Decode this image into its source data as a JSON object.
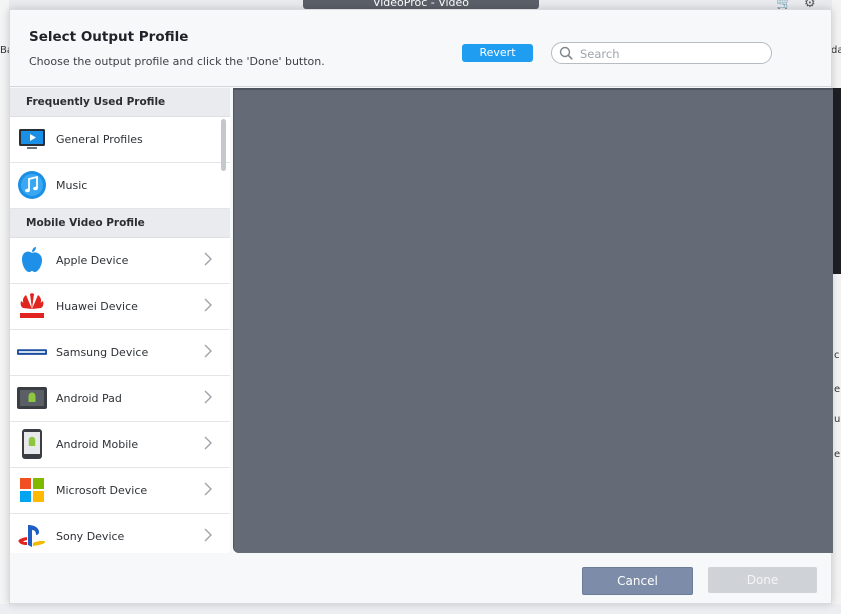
{
  "background_app": {
    "window_title": "VideoProc - Video",
    "left_fragment": "Ba",
    "right_fragment": "da",
    "side_fragments": [
      "c",
      "e",
      "u",
      "e"
    ]
  },
  "dialog": {
    "title": "Select Output Profile",
    "subtitle": "Choose the output profile and click the 'Done' button.",
    "revert_label": "Revert",
    "search_placeholder": "Search",
    "search_value": "",
    "sections": [
      {
        "header": "Frequently Used Profile",
        "items": [
          {
            "label": "General Profiles",
            "icon": "monitor-icon",
            "has_chevron": false
          },
          {
            "label": "Music",
            "icon": "music-note-icon",
            "has_chevron": false
          }
        ]
      },
      {
        "header": "Mobile Video Profile",
        "items": [
          {
            "label": "Apple Device",
            "icon": "apple-logo-icon",
            "has_chevron": true
          },
          {
            "label": "Huawei Device",
            "icon": "huawei-logo-icon",
            "has_chevron": true
          },
          {
            "label": "Samsung Device",
            "icon": "samsung-logo-icon",
            "has_chevron": true
          },
          {
            "label": "Android Pad",
            "icon": "android-pad-icon",
            "has_chevron": true
          },
          {
            "label": "Android Mobile",
            "icon": "android-mobile-icon",
            "has_chevron": true
          },
          {
            "label": "Microsoft Device",
            "icon": "microsoft-logo-icon",
            "has_chevron": true
          },
          {
            "label": "Sony Device",
            "icon": "playstation-logo-icon",
            "has_chevron": true
          }
        ]
      }
    ],
    "cancel_label": "Cancel",
    "done_label": "Done"
  },
  "colors": {
    "accent": "#1f9df0",
    "cancel": "#7d8ca9",
    "done_disabled": "#cfd2d7",
    "preview": "#646b76"
  }
}
